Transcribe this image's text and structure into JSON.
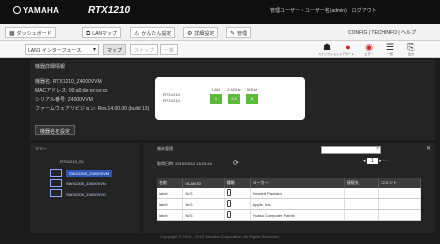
{
  "header": {
    "brand": "YAMAHA",
    "model": "RTX1210",
    "links": "管理ユーザー・ユーザー名(admin)　ログアウト"
  },
  "tabs": [
    {
      "icon": "▦",
      "label": "ダッシュボード"
    },
    {
      "icon": "⧉",
      "label": "LANマップ"
    },
    {
      "icon": "⚠",
      "label": "かんたん設定"
    },
    {
      "icon": "⚙",
      "label": "詳細設定"
    },
    {
      "icon": "✎",
      "label": "管理"
    }
  ],
  "top_right_links": "CONFIG | TECHINFO | ヘルプ",
  "toolbar": {
    "interface_select": "LAN1 インターフェース",
    "seg_map": "マップ",
    "seg_other1": "スナップ",
    "seg_other2": "一覧",
    "icons": [
      {
        "name": "snapshot-icon",
        "label": "スナップショット",
        "red": false
      },
      {
        "name": "alert-icon",
        "label": "アラート",
        "red": true
      },
      {
        "name": "error-icon",
        "label": "エラー",
        "red": true
      },
      {
        "name": "list-icon",
        "label": "一覧",
        "red": false
      },
      {
        "name": "export-icon",
        "label": "出力",
        "red": false
      }
    ]
  },
  "device_panel": {
    "title": "機器詳細情報",
    "info": [
      "機器名: RTX1210_Z4000VVM",
      "MACアドレス: 00:a0:de:xx:xx:xx",
      "シリアル番号: Z4000VVM",
      "ファームウェアリビジョン: Rev.14.00.00 (build 13)"
    ],
    "button": "機器名を設定",
    "card_name_line1": "RTX1210",
    "card_name_line2": "RTX1210",
    "ports": [
      {
        "label": "LAN",
        "value": "1"
      },
      {
        "label": "2.4GHz",
        "value": "2.4"
      },
      {
        "label": "5GHz",
        "value": "5"
      }
    ]
  },
  "tree": {
    "title": "ツリー",
    "items": [
      "RTX1210_S1",
      "SWX2200_Z4000VVM",
      "SWX2200_Z4000VVN",
      "SWX2200_Z4000VVO"
    ]
  },
  "list_panel": {
    "title": "端末管理",
    "updated": "取得日時: 2015/03/12 15:23:44",
    "page": "1",
    "columns": [
      "名前",
      "VLAN ID",
      "種類",
      "メーカー",
      "接続先",
      "コメント"
    ],
    "rows": [
      [
        "label",
        "N/G",
        "phone",
        "Hewlett Packard",
        "",
        ""
      ],
      [
        "label",
        "N/G",
        "phone",
        "Apple, Inc.",
        "",
        ""
      ],
      [
        "label",
        "N/G",
        "phone",
        "Yuasa Computer Fabrik",
        "",
        ""
      ]
    ]
  },
  "footer": "Copyright © 2014 - 2015 Yamaha Corporation. All Rights Reserved."
}
